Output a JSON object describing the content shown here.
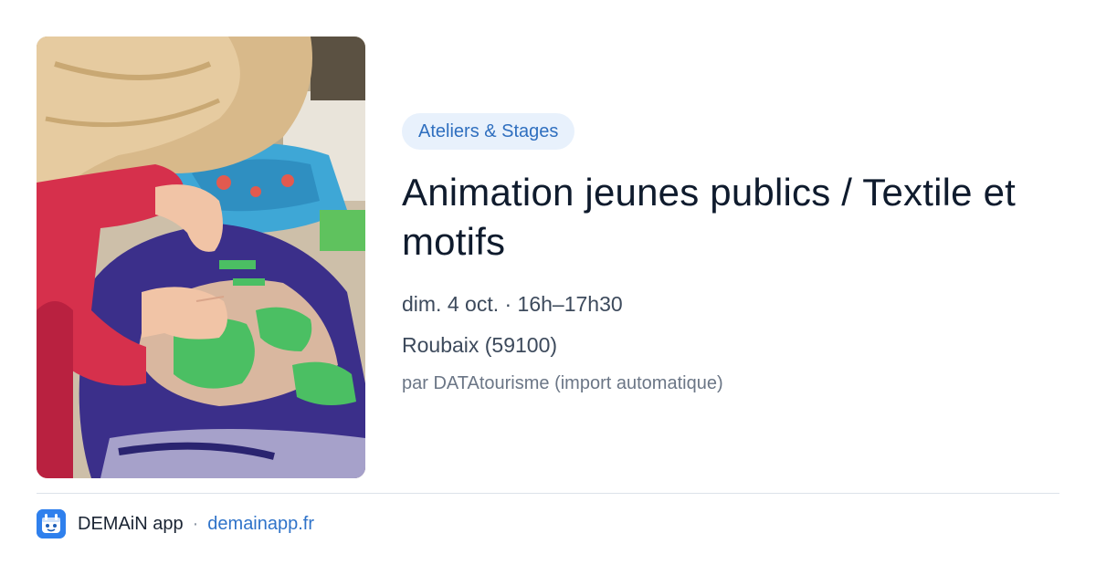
{
  "image": {
    "alt_icon": "photo-child-sewing-textile-cushion"
  },
  "event": {
    "category": "Ateliers & Stages",
    "title": "Animation jeunes publics / Textile et motifs",
    "datetime": "dim. 4 oct. · 16h–17h30",
    "location": "Roubaix (59100)",
    "source": "par DATAtourisme (import automatique)"
  },
  "footer": {
    "logo_icon": "demain-app-logo-icon",
    "app_name": "DEMAiN app",
    "separator": "·",
    "link": "demainapp.fr"
  },
  "colors": {
    "badge_bg": "#e8f1fc",
    "badge_text": "#2f6fbf",
    "title": "#0f1b2d",
    "meta": "#3d4a5c",
    "source": "#6b7686",
    "link": "#2f73c9",
    "logo": "#2f80ed"
  }
}
